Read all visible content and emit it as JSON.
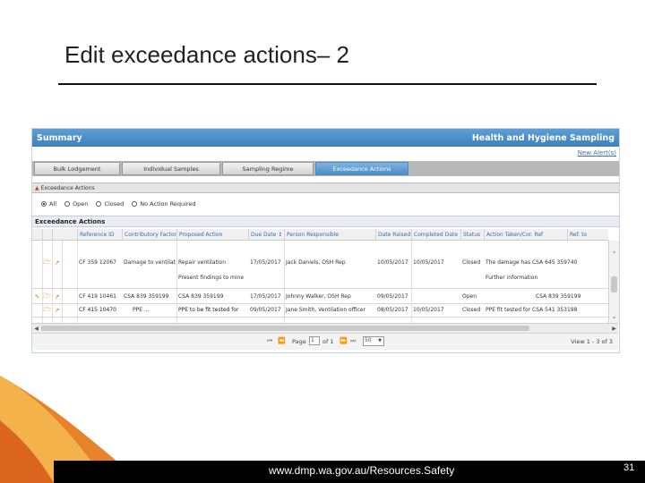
{
  "slide": {
    "title": "Edit exceedance actions– 2",
    "footer_url": "www.dmp.wa.gov.au/Resources.Safety",
    "page_number": "31"
  },
  "app": {
    "topbar": {
      "left": "Summary",
      "right": "Health and Hygiene Sampling"
    },
    "new_alert": "New Alert(s)",
    "tabs": [
      "Bulk Lodgement",
      "Individual Samples",
      "Sampling Regime",
      "Exceedance Actions"
    ],
    "active_tab": 3,
    "section_title": "Exceedance Actions",
    "radios": [
      {
        "label": "All",
        "checked": true
      },
      {
        "label": "Open",
        "checked": false
      },
      {
        "label": "Closed",
        "checked": false
      },
      {
        "label": "No Action Required",
        "checked": false
      }
    ],
    "grid": {
      "caption": "Exceedance Actions",
      "columns": [
        "Reference ID",
        "Contributory Factor",
        "Proposed Action",
        "Due Date ↕",
        "Person Responsible",
        "Date Raised",
        "Completed Date",
        "Status",
        "Action Taken/Cor. Ref",
        "Ref. to"
      ],
      "rows": [
        {
          "reference": "CF 359 12067",
          "factor": "Damage to ventilat",
          "action": "Repair ventilation",
          "action2": "Present findings to mine",
          "due": "17/05/2017",
          "person": "Jack Daniels, OSH Rep",
          "raised": "10/05/2017",
          "completed": "10/05/2017",
          "status": "Closed",
          "taken": "The damage has CSA 645 359740",
          "taken2": "Further information"
        },
        {
          "reference": "CF 419 10461",
          "factor": "CSA 839 359199",
          "action": "CSA 839 359199",
          "due": "17/05/2017",
          "person": "Johnny Walker, OSH Rep",
          "raised": "09/05/2017",
          "completed": "",
          "status": "Open",
          "taken": "CSA 839 359199"
        },
        {
          "reference": "CF 415 10470",
          "factor": "PPE ...",
          "action": "PPE to be fit tested for",
          "due": "09/05/2017",
          "person": "Jane Smith, Ventilation officer",
          "raised": "08/05/2017",
          "completed": "10/05/2017",
          "status": "Closed",
          "taken": "PPE fit tested for CSA 541 353198"
        }
      ]
    },
    "pager": {
      "page_label": "Page",
      "page_value": "1",
      "of_label": "of 1",
      "rows_value": "50",
      "view_text": "View 1 - 3 of 3"
    }
  }
}
